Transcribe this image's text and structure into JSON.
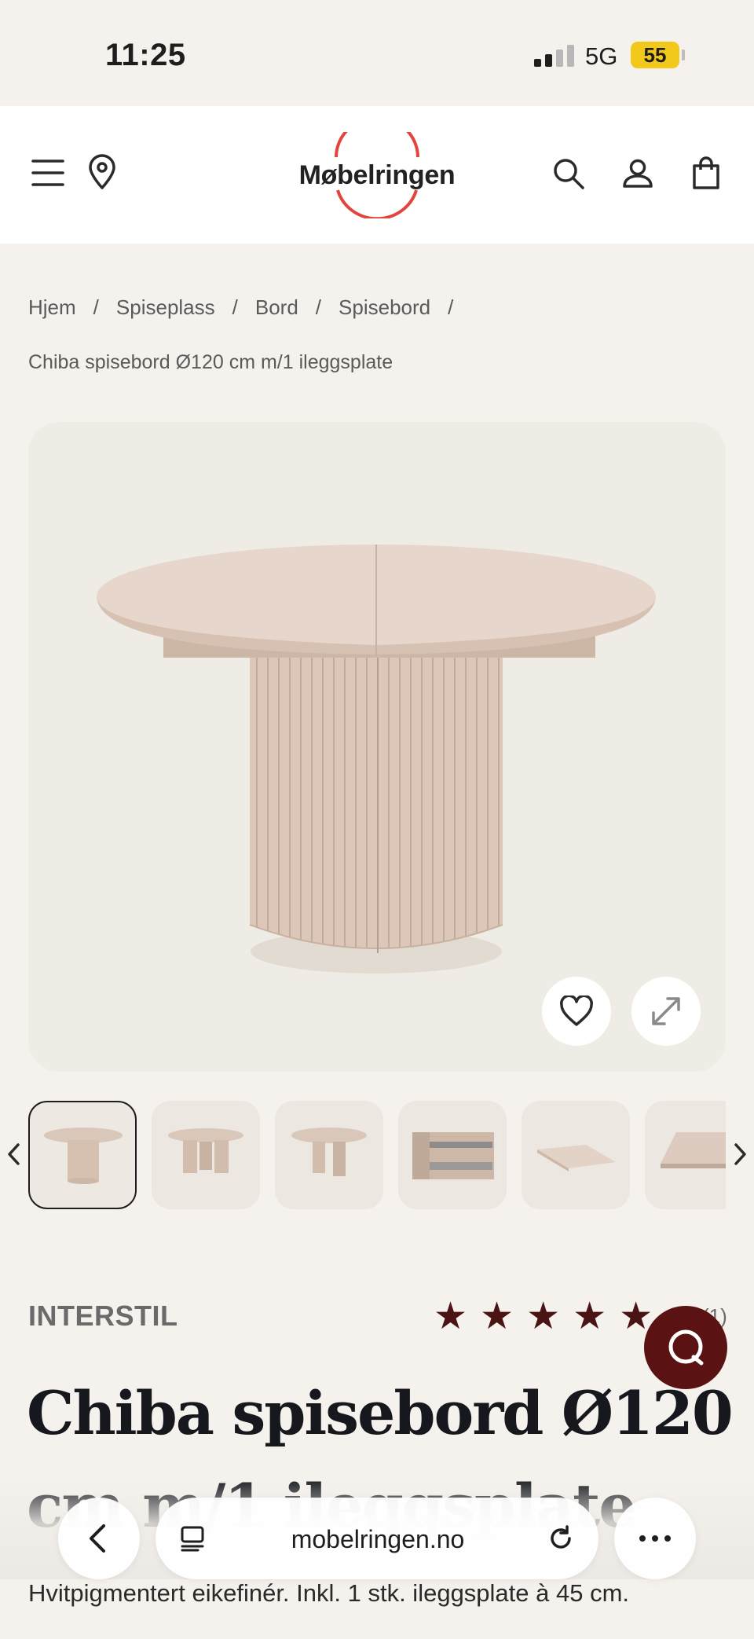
{
  "status": {
    "time": "11:25",
    "network": "5G",
    "battery": "55"
  },
  "header": {
    "logo_text": "Møbelringen",
    "icons": [
      "menu-icon",
      "location-pin-icon",
      "search-icon",
      "account-icon",
      "cart-icon"
    ]
  },
  "breadcrumb": {
    "items": [
      "Hjem",
      "Spiseplass",
      "Bord",
      "Spisebord"
    ],
    "separator": "/",
    "current": "Chiba spisebord Ø120 cm m/1 ileggsplate"
  },
  "product": {
    "brand": "INTERSTIL",
    "rating": 5,
    "review_count": "(1)",
    "title": "Chiba spisebord Ø120 cm m/1 ileggsplate",
    "description": "Hvitpigmentert eikefinér. Inkl. 1 stk. ileggsplate à 45 cm.",
    "thumbnail_count": 6,
    "active_thumbnail": 1
  },
  "browser": {
    "url": "mobelringen.no"
  },
  "colors": {
    "accent": "#5a1212",
    "star": "#4a1414",
    "logo_ring": "#e2453c",
    "wood": "#d9c5b6"
  }
}
